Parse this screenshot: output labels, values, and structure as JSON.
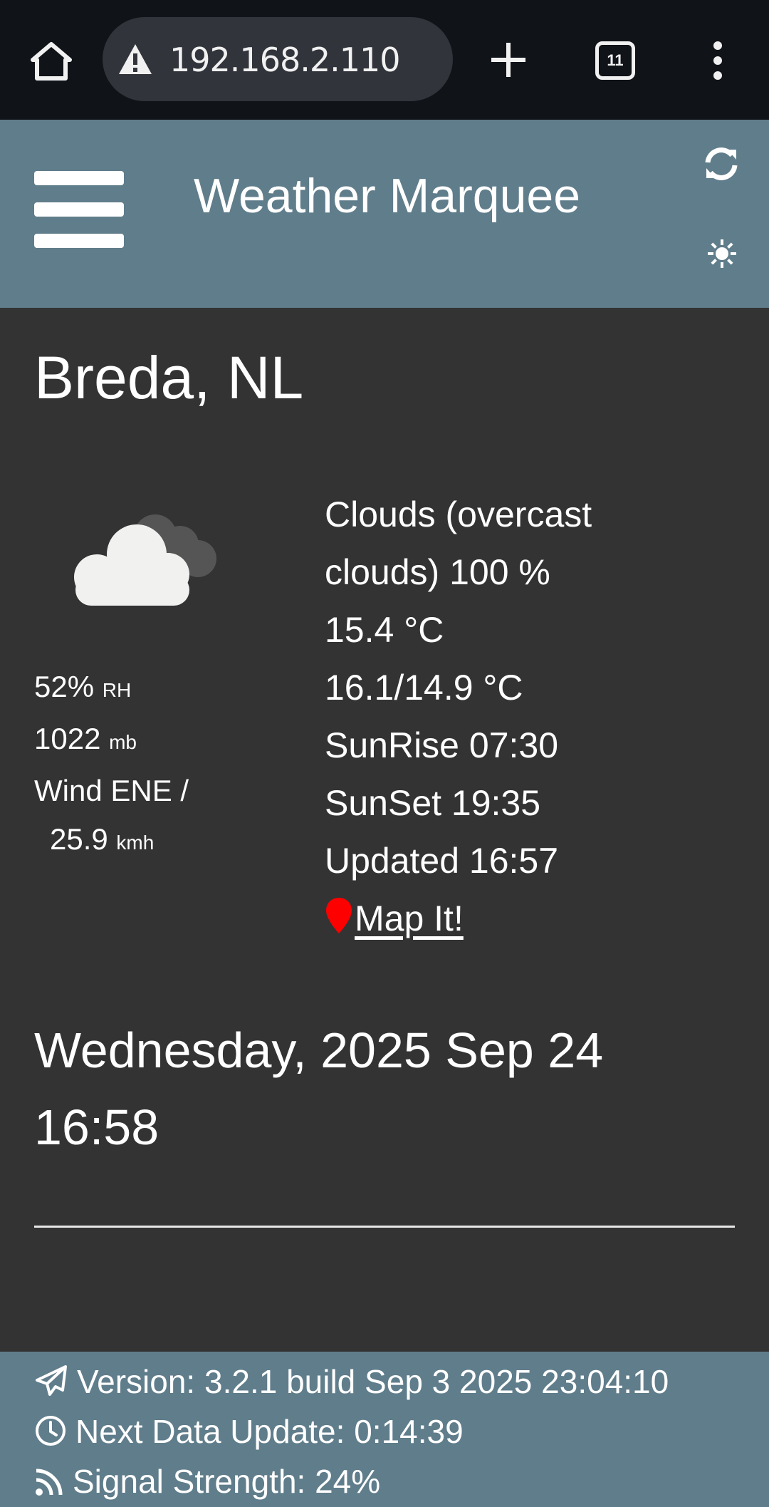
{
  "browser": {
    "url": "192.168.2.110",
    "tab_count": "11"
  },
  "header": {
    "title": "Weather Marquee"
  },
  "weather": {
    "city": "Breda, NL",
    "humidity_value": "52%",
    "humidity_unit": "RH",
    "pressure_value": "1022",
    "pressure_unit": "mb",
    "wind_label": "Wind ENE /",
    "wind_value": "25.9",
    "wind_unit": "kmh",
    "description_line1": "Clouds (overcast",
    "description_line2": "clouds) 100 %",
    "temperature": "15.4 °C",
    "high_low": "16.1/14.9 °C",
    "sunrise": "SunRise 07:30",
    "sunset": "SunSet 19:35",
    "updated": "Updated 16:57",
    "map_link": " Map It!",
    "pin_color": "#ff0000"
  },
  "clock": {
    "date": "Wednesday, 2025 Sep 24",
    "time": "16:58"
  },
  "footer": {
    "version": "Version: 3.2.1 build Sep 3 2025 23:04:10",
    "next_update": "Next Data Update: 0:14:39",
    "signal": "Signal Strength: 24%"
  },
  "colors": {
    "header_bg": "#607d8b",
    "page_bg": "#333333",
    "chrome_bg": "#101318"
  },
  "icons": [
    "home-icon",
    "warning-icon",
    "plus-icon",
    "tabs-icon",
    "more-icon",
    "menu-icon",
    "refresh-icon",
    "brightness-icon",
    "cloud-icon",
    "map-pin-icon",
    "paper-plane-icon",
    "clock-icon",
    "rss-icon"
  ]
}
